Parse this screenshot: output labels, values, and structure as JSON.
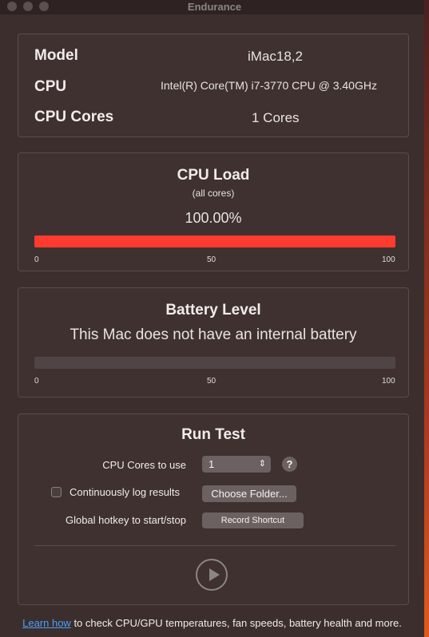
{
  "window": {
    "title": "Endurance"
  },
  "system_info": {
    "model_label": "Model",
    "model_value": "iMac18,2",
    "cpu_label": "CPU",
    "cpu_value": "Intel(R) Core(TM) i7-3770 CPU @ 3.40GHz",
    "cores_label": "CPU Cores",
    "cores_value": "1 Cores"
  },
  "cpu_load": {
    "title": "CPU Load",
    "subtitle": "(all cores)",
    "value_text": "100.00%",
    "percent": 100,
    "bar_color": "#ff3b30",
    "ticks": [
      "0",
      "50",
      "100"
    ]
  },
  "battery": {
    "title": "Battery Level",
    "message": "This Mac does not have an internal battery",
    "percent": 0,
    "ticks": [
      "0",
      "50",
      "100"
    ]
  },
  "run_test": {
    "title": "Run Test",
    "cores_label": "CPU Cores to use",
    "cores_selected": "1",
    "help_label": "?",
    "log_label": "Continuously log results",
    "log_checked": false,
    "choose_folder_label": "Choose Folder...",
    "hotkey_label": "Global hotkey to start/stop",
    "record_shortcut_label": "Record Shortcut"
  },
  "footer": {
    "link_text": "Learn how",
    "text": " to check CPU/GPU temperatures, fan speeds, battery health and more."
  }
}
